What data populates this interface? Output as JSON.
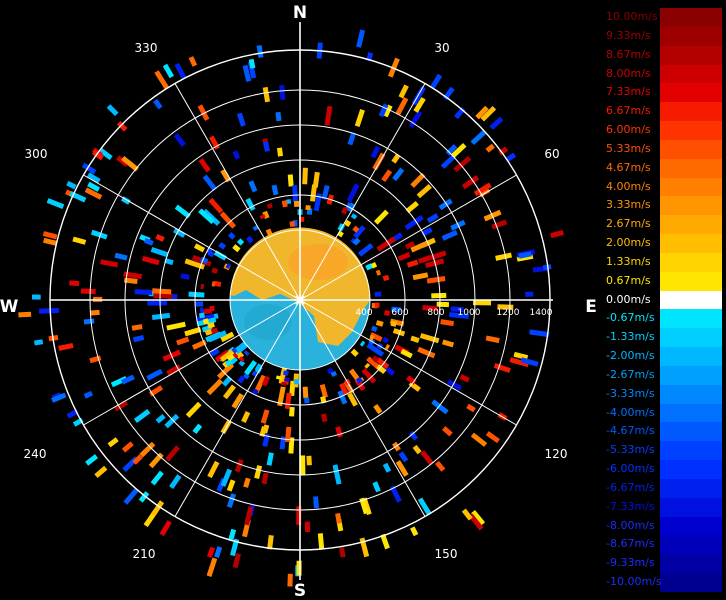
{
  "radar": {
    "compass": {
      "north": "N",
      "east": "E",
      "south": "S",
      "west": "W"
    },
    "bearings": [
      "30",
      "60",
      "120",
      "150",
      "210",
      "240",
      "300",
      "330"
    ],
    "range_labels": [
      "400",
      "600",
      "800",
      "1000",
      "1200",
      "1400"
    ],
    "colors": {
      "background": "#000000",
      "grid": "#ffffff"
    }
  },
  "legend": {
    "entries": [
      {
        "label": "10.00m/s",
        "color": "#8b0000"
      },
      {
        "label": "9.33m/s",
        "color": "#9e0000"
      },
      {
        "label": "8.67m/s",
        "color": "#b50000"
      },
      {
        "label": "8.00m/s",
        "color": "#cc0000"
      },
      {
        "label": "7.33m/s",
        "color": "#e30000"
      },
      {
        "label": "6.67m/s",
        "color": "#f51a00"
      },
      {
        "label": "6.00m/s",
        "color": "#ff3300"
      },
      {
        "label": "5.33m/s",
        "color": "#ff5000"
      },
      {
        "label": "4.67m/s",
        "color": "#ff6a00"
      },
      {
        "label": "4.00m/s",
        "color": "#ff8000"
      },
      {
        "label": "3.33m/s",
        "color": "#ff9500"
      },
      {
        "label": "2.67m/s",
        "color": "#ffaa00"
      },
      {
        "label": "2.00m/s",
        "color": "#ffbf00"
      },
      {
        "label": "1.33m/s",
        "color": "#ffd400"
      },
      {
        "label": "0.67m/s",
        "color": "#ffe600"
      },
      {
        "label": "0.00m/s",
        "color": "#ffffff"
      },
      {
        "label": "-0.67m/s",
        "color": "#00e5ff"
      },
      {
        "label": "-1.33m/s",
        "color": "#00cfff"
      },
      {
        "label": "-2.00m/s",
        "color": "#00b8ff"
      },
      {
        "label": "-2.67m/s",
        "color": "#00a0ff"
      },
      {
        "label": "-3.33m/s",
        "color": "#0088ff"
      },
      {
        "label": "-4.00m/s",
        "color": "#0070ff"
      },
      {
        "label": "-4.67m/s",
        "color": "#0058ff"
      },
      {
        "label": "-5.33m/s",
        "color": "#0040ff"
      },
      {
        "label": "-6.00m/s",
        "color": "#0030ff"
      },
      {
        "label": "-6.67m/s",
        "color": "#0020f0"
      },
      {
        "label": "-7.33m/s",
        "color": "#0010e0"
      },
      {
        "label": "-8.00m/s",
        "color": "#0000d0"
      },
      {
        "label": "-8.67m/s",
        "color": "#0000bb"
      },
      {
        "label": "-9.33m/s",
        "color": "#0000a5"
      },
      {
        "label": "-10.00m/s",
        "color": "#000090"
      }
    ]
  }
}
